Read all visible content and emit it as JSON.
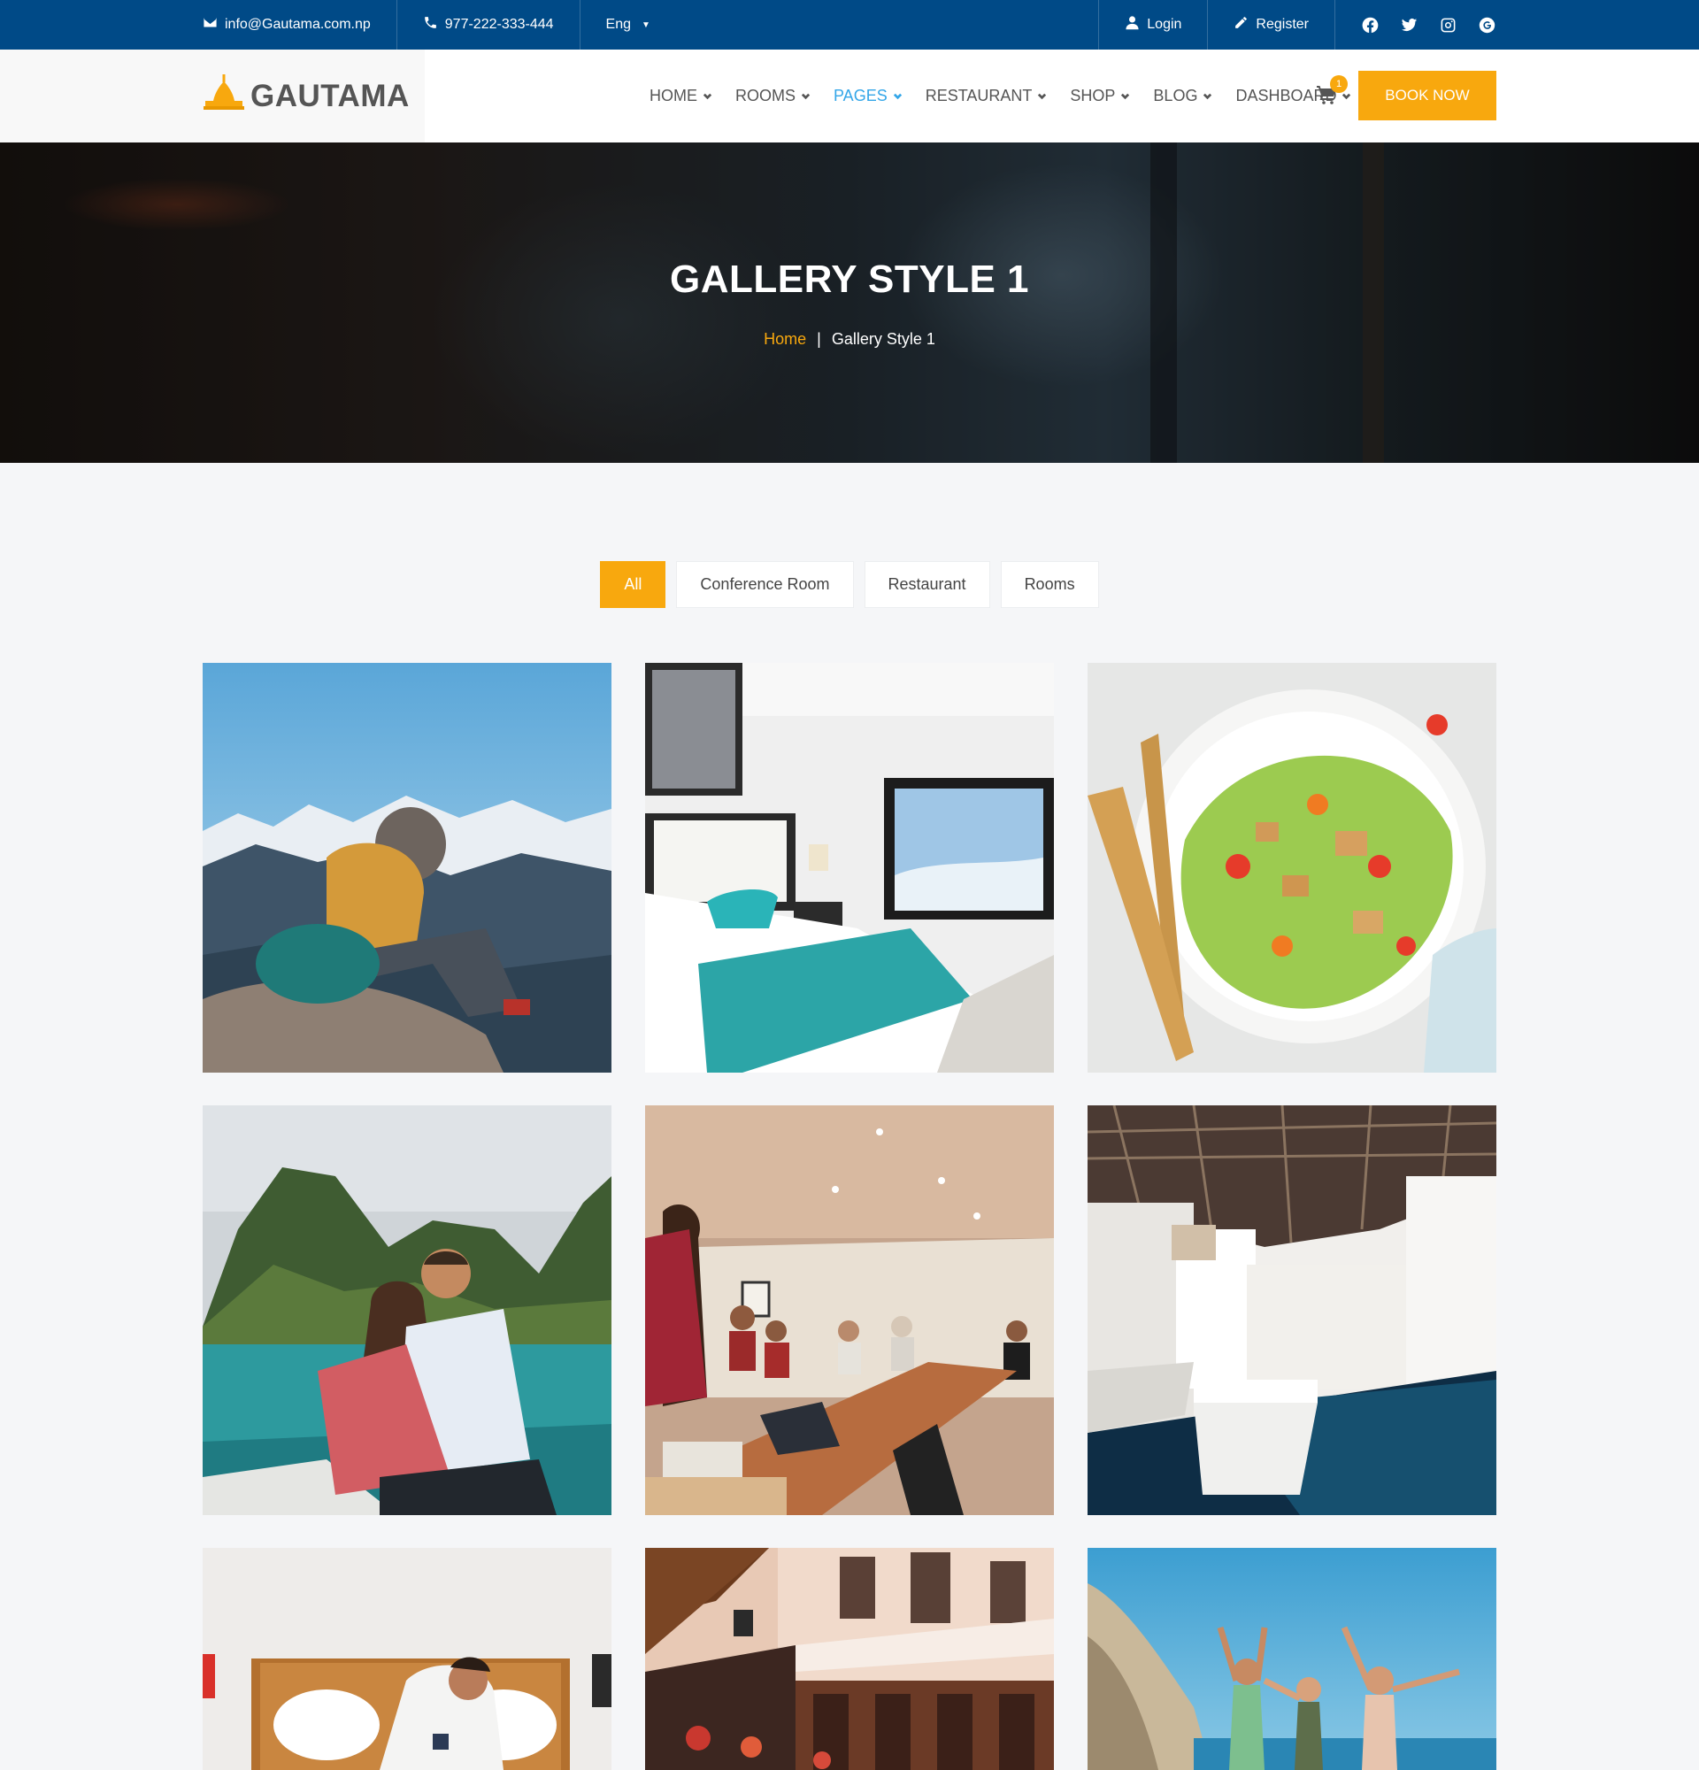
{
  "topbar": {
    "email": "info@Gautama.com.np",
    "phone": "977-222-333-444",
    "language": "Eng",
    "login": "Login",
    "register": "Register",
    "social_icons": [
      "facebook-icon",
      "twitter-icon",
      "instagram-icon",
      "google-plus-icon"
    ]
  },
  "header": {
    "brand": "GAUTAMA",
    "nav": [
      {
        "label": "HOME"
      },
      {
        "label": "ROOMS"
      },
      {
        "label": "PAGES",
        "active": true
      },
      {
        "label": "RESTAURANT"
      },
      {
        "label": "SHOP"
      },
      {
        "label": "BLOG"
      },
      {
        "label": "DASHBOARD"
      }
    ],
    "cart_count": "1",
    "book_now": "BOOK NOW"
  },
  "hero": {
    "title": "GALLERY STYLE 1",
    "breadcrumb": {
      "home": "Home",
      "separator": "|",
      "current": "Gallery Style 1"
    }
  },
  "filters": [
    {
      "label": "All",
      "active": true
    },
    {
      "label": "Conference Room"
    },
    {
      "label": "Restaurant"
    },
    {
      "label": "Rooms"
    }
  ],
  "gallery": [
    "hiker-on-mountain-photo",
    "hotel-bedroom-photo",
    "salad-plate-photo",
    "couple-on-boat-photo",
    "conference-meeting-photo",
    "museum-pool-photo",
    "man-in-bed-photo",
    "hotel-facade-photo",
    "friends-on-beach-photo"
  ],
  "colors": {
    "topbar": "#004a87",
    "accent": "#f8a80e",
    "nav_active": "#33a6e8",
    "page_bg": "#f5f6f8"
  }
}
